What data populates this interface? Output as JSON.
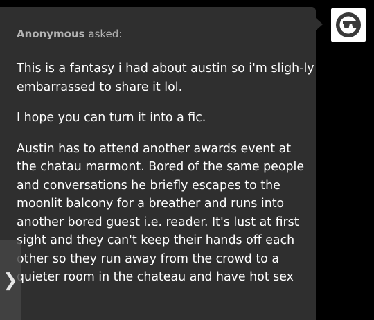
{
  "ask": {
    "asker_name": "Anonymous",
    "asked_label": "asked:",
    "paragraphs": [
      "This is a fantasy i had about austin so i'm sligh-ly embarrassed to share it lol.",
      "I hope you can turn it into a fic.",
      "Austin has to attend another awards event at the chatau marmont. Bored of the same people and conversations he briefly escapes to the moonlit balcony for a breather and runs into another bored guest i.e. reader. It's lust at first sight and they can't keep their hands off each other so they run away from the crowd to a quieter room in the chateau and have hot sex"
    ]
  },
  "avatar": {
    "icon": "sunglasses-face-icon"
  },
  "expand_tab": {
    "icon": "chevron-right-icon",
    "glyph": "❯"
  },
  "colors": {
    "background": "#000000",
    "bubble": "#2f2f2f",
    "text": "#ffffff",
    "muted": "#b3b3b3"
  }
}
